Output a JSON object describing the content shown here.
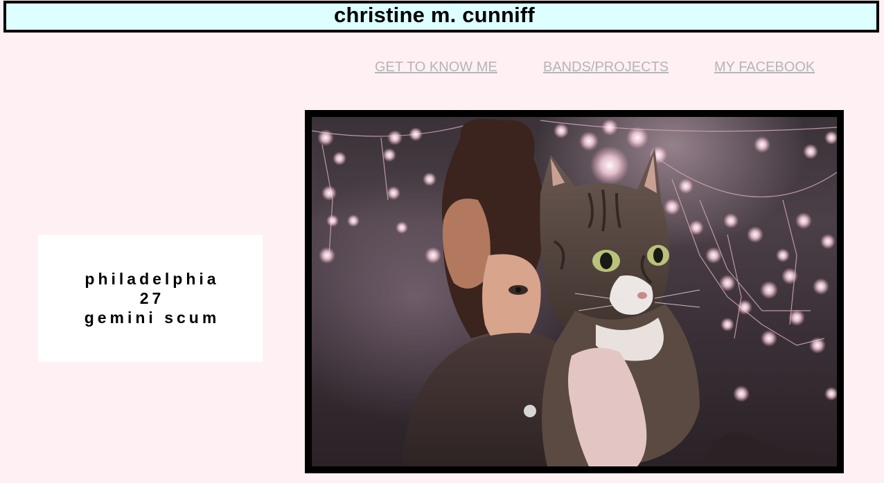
{
  "header": {
    "title": "christine m. cunniff",
    "background_color": "#ddffff"
  },
  "nav": {
    "links": [
      {
        "label": "GET TO KNOW ME"
      },
      {
        "label": "BANDS/PROJECTS"
      },
      {
        "label": "MY FACEBOOK"
      }
    ],
    "link_color": "#b5b5b5"
  },
  "info": {
    "lines": [
      "philadelphia",
      "27",
      "gemini scum"
    ]
  },
  "photo": {
    "description_icon": "profile-photo-with-cat"
  },
  "colors": {
    "page_background": "#fff0f4",
    "frame": "#000000"
  }
}
